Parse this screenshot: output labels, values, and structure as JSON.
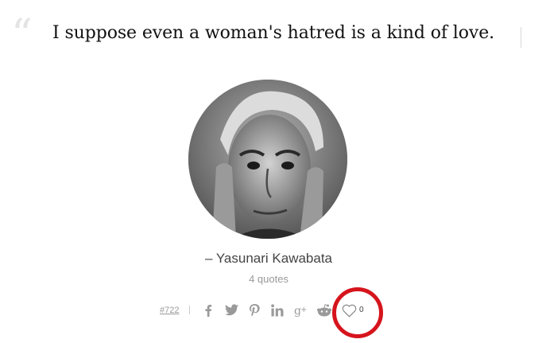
{
  "quote": {
    "mark": "“",
    "text": "I suppose even a woman's hatred is a kind of love."
  },
  "author": {
    "name": "– Yasunari Kawabata",
    "count": "4 quotes"
  },
  "meta": {
    "id_link": "#722",
    "like_count": "0"
  },
  "icons": [
    "facebook-icon",
    "twitter-icon",
    "pinterest-icon",
    "linkedin-icon",
    "google-plus-icon",
    "reddit-icon",
    "heart-icon"
  ],
  "colors": {
    "highlight": "#d6141c",
    "muted": "#9a9a9a"
  }
}
